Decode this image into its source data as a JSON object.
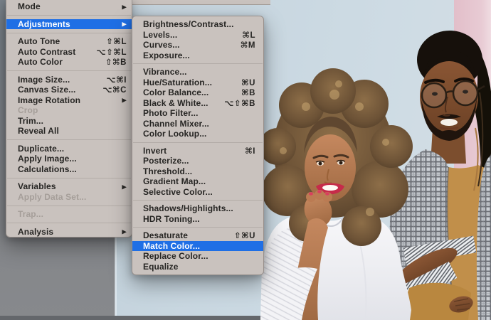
{
  "icons": {
    "submenu_arrow": "▶"
  },
  "colors": {
    "accent": "#1f6fe5",
    "menu_bg": "#c9c2be",
    "menu_text": "#262523",
    "menu_disabled": "#a59e99",
    "menu_separator": "#b3aca7",
    "wall_gray": "#80858b",
    "wall_blue": "#cbd9e2",
    "wall_pink": "#e5c4cf",
    "blouse_white": "#f3f3f6",
    "blazer_plaid": "#ccd0d5",
    "shirt_mustard": "#c18f4a"
  },
  "left_menu": {
    "items": [
      {
        "label": "Mode",
        "submenu": true
      },
      {
        "type": "separator"
      },
      {
        "label": "Adjustments",
        "submenu": true,
        "state": "highlighted"
      },
      {
        "type": "separator"
      },
      {
        "label": "Auto Tone",
        "shortcut": "⇧⌘L"
      },
      {
        "label": "Auto Contrast",
        "shortcut": "⌥⇧⌘L"
      },
      {
        "label": "Auto Color",
        "shortcut": "⇧⌘B"
      },
      {
        "type": "separator"
      },
      {
        "label": "Image Size...",
        "shortcut": "⌥⌘I"
      },
      {
        "label": "Canvas Size...",
        "shortcut": "⌥⌘C"
      },
      {
        "label": "Image Rotation",
        "submenu": true
      },
      {
        "label": "Crop",
        "state": "disabled"
      },
      {
        "label": "Trim..."
      },
      {
        "label": "Reveal All"
      },
      {
        "type": "separator"
      },
      {
        "label": "Duplicate..."
      },
      {
        "label": "Apply Image..."
      },
      {
        "label": "Calculations..."
      },
      {
        "type": "separator"
      },
      {
        "label": "Variables",
        "submenu": true
      },
      {
        "label": "Apply Data Set...",
        "state": "disabled"
      },
      {
        "type": "separator"
      },
      {
        "label": "Trap...",
        "state": "disabled"
      },
      {
        "type": "separator"
      },
      {
        "label": "Analysis",
        "submenu": true
      }
    ]
  },
  "submenu": {
    "items": [
      {
        "label": "Brightness/Contrast..."
      },
      {
        "label": "Levels...",
        "shortcut": "⌘L"
      },
      {
        "label": "Curves...",
        "shortcut": "⌘M"
      },
      {
        "label": "Exposure..."
      },
      {
        "type": "separator"
      },
      {
        "label": "Vibrance..."
      },
      {
        "label": "Hue/Saturation...",
        "shortcut": "⌘U"
      },
      {
        "label": "Color Balance...",
        "shortcut": "⌘B"
      },
      {
        "label": "Black & White...",
        "shortcut": "⌥⇧⌘B"
      },
      {
        "label": "Photo Filter..."
      },
      {
        "label": "Channel Mixer..."
      },
      {
        "label": "Color Lookup..."
      },
      {
        "type": "separator"
      },
      {
        "label": "Invert",
        "shortcut": "⌘I"
      },
      {
        "label": "Posterize..."
      },
      {
        "label": "Threshold..."
      },
      {
        "label": "Gradient Map..."
      },
      {
        "label": "Selective Color..."
      },
      {
        "type": "separator"
      },
      {
        "label": "Shadows/Highlights..."
      },
      {
        "label": "HDR Toning..."
      },
      {
        "type": "separator"
      },
      {
        "label": "Desaturate",
        "shortcut": "⇧⌘U"
      },
      {
        "label": "Match Color...",
        "state": "highlighted"
      },
      {
        "label": "Replace Color..."
      },
      {
        "label": "Equalize"
      }
    ]
  }
}
